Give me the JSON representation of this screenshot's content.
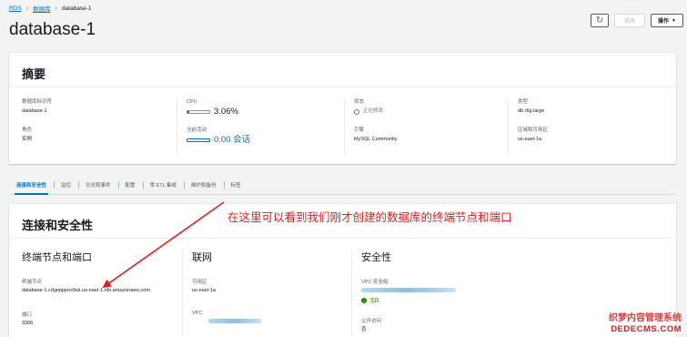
{
  "breadcrumb": {
    "root": "RDS",
    "section": "数据库",
    "current": "database-1"
  },
  "title": "database-1",
  "toolbar": {
    "refresh_glyph": "↻",
    "modify_label": "修改",
    "actions_label": "操作"
  },
  "summary": {
    "heading": "摘要",
    "fields": {
      "db_id_label": "数据库标识符",
      "db_id_value": "database-1",
      "role_label": "角色",
      "role_value": "实例",
      "cpu_label": "CPU",
      "cpu_value": "3.06%",
      "cpu_fraction": 0.0306,
      "activity_label": "当前活动",
      "activity_value": "0.00 会话",
      "activity_fraction": 0,
      "status_label": "状态",
      "status_value": "正在修改",
      "engine_label": "引擎",
      "engine_value": "MySQL Community",
      "class_label": "类型",
      "class_value": "db.r6g.large",
      "az_label": "区域和可用区",
      "az_value": "us-east-1a"
    }
  },
  "tabs": [
    {
      "label": "连接和安全性",
      "active": true
    },
    {
      "label": "监控"
    },
    {
      "label": "日志和事件"
    },
    {
      "label": "配置"
    },
    {
      "label": "零 ETL 集成"
    },
    {
      "label": "维护和备份"
    },
    {
      "label": "标签"
    }
  ],
  "connectivity": {
    "heading": "连接和安全性",
    "endpoint": {
      "heading": "终端节点和端口",
      "endpoint_label": "终端节点",
      "endpoint_value": "database-1.cdgepppox9sk.us-east-1.rds.amazonaws.com",
      "port_label": "端口",
      "port_value": "3306"
    },
    "network": {
      "heading": "联网",
      "az_label": "可用区",
      "az_value": "us-east-1a",
      "vpc_label": "VPC"
    },
    "security": {
      "heading": "安全性",
      "sg_label": "VPC 安全组",
      "sg_status": "活跃",
      "public_label": "公开访问",
      "public_value": "否"
    }
  },
  "annotation": {
    "text": "在这里可以看到我们刚才创建的数据库的终端节点和端口",
    "color": "#e0201f"
  },
  "watermark": {
    "line1": "织梦内容管理系统",
    "line2": "DEDECMS.COM"
  }
}
